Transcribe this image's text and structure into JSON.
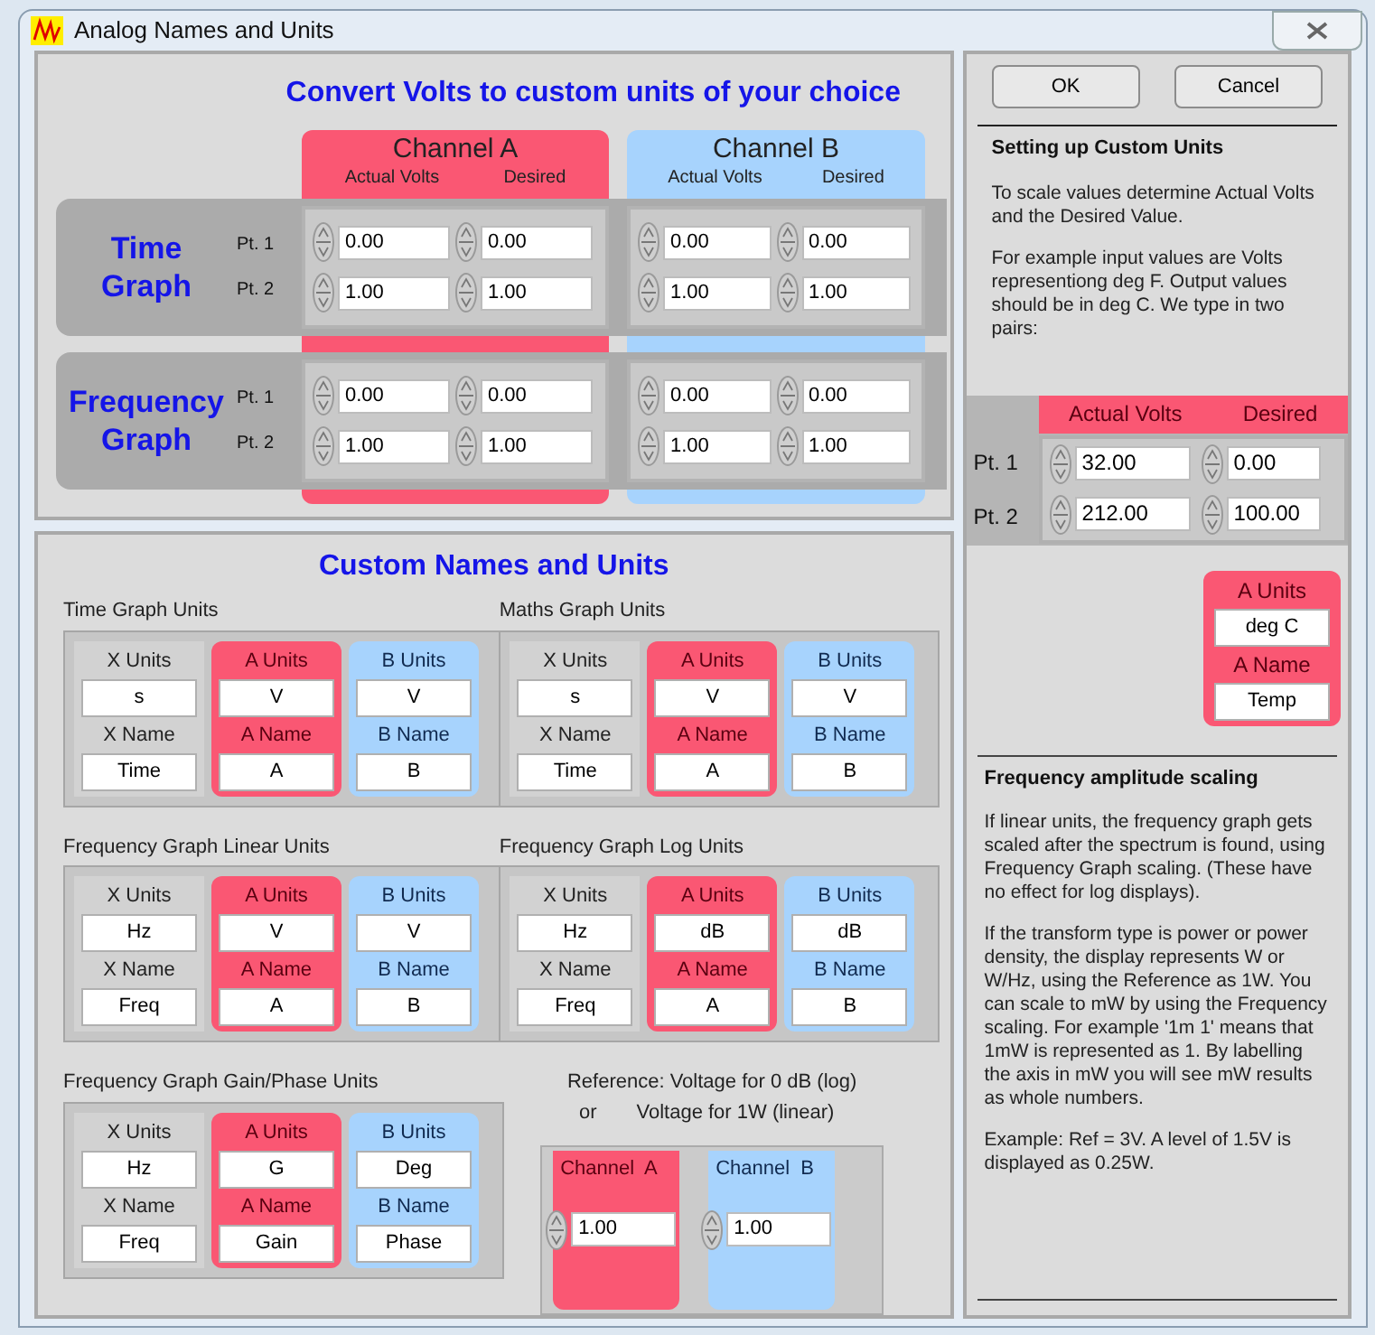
{
  "window": {
    "title": "Analog Names and Units"
  },
  "convert": {
    "title": "Convert Volts to custom units of your choice",
    "channels": [
      {
        "kind": "a",
        "name": "Channel A",
        "columns": [
          "Actual Volts",
          "Desired"
        ]
      },
      {
        "kind": "b",
        "name": "Channel B",
        "columns": [
          "Actual Volts",
          "Desired"
        ]
      }
    ],
    "graphs": [
      {
        "label_lines": [
          "Time",
          "Graph"
        ],
        "points": [
          "Pt. 1",
          "Pt. 2"
        ],
        "values": [
          [
            [
              "0.00",
              "0.00"
            ],
            [
              "1.00",
              "1.00"
            ]
          ],
          [
            [
              "0.00",
              "0.00"
            ],
            [
              "1.00",
              "1.00"
            ]
          ]
        ]
      },
      {
        "label_lines": [
          "Frequency",
          "Graph"
        ],
        "points": [
          "Pt. 1",
          "Pt. 2"
        ],
        "values": [
          [
            [
              "0.00",
              "0.00"
            ],
            [
              "1.00",
              "1.00"
            ]
          ],
          [
            [
              "0.00",
              "0.00"
            ],
            [
              "1.00",
              "1.00"
            ]
          ]
        ]
      }
    ]
  },
  "custom": {
    "title": "Custom Names and Units",
    "groups": [
      {
        "title": "Time Graph Units",
        "columns": [
          {
            "kind": "x",
            "units_label": "X Units",
            "units": "s",
            "name_label": "X Name",
            "name": "Time"
          },
          {
            "kind": "a",
            "units_label": "A Units",
            "units": "V",
            "name_label": "A Name",
            "name": "A"
          },
          {
            "kind": "b",
            "units_label": "B Units",
            "units": "V",
            "name_label": "B Name",
            "name": "B"
          }
        ]
      },
      {
        "title": "Maths Graph Units",
        "columns": [
          {
            "kind": "x",
            "units_label": "X Units",
            "units": "s",
            "name_label": "X Name",
            "name": "Time"
          },
          {
            "kind": "a",
            "units_label": "A Units",
            "units": "V",
            "name_label": "A Name",
            "name": "A"
          },
          {
            "kind": "b",
            "units_label": "B Units",
            "units": "V",
            "name_label": "B Name",
            "name": "B"
          }
        ]
      },
      {
        "title": "Frequency Graph Linear Units",
        "columns": [
          {
            "kind": "x",
            "units_label": "X Units",
            "units": "Hz",
            "name_label": "X Name",
            "name": "Freq"
          },
          {
            "kind": "a",
            "units_label": "A Units",
            "units": "V",
            "name_label": "A Name",
            "name": "A"
          },
          {
            "kind": "b",
            "units_label": "B Units",
            "units": "V",
            "name_label": "B Name",
            "name": "B"
          }
        ]
      },
      {
        "title": "Frequency Graph Log Units",
        "columns": [
          {
            "kind": "x",
            "units_label": "X Units",
            "units": "Hz",
            "name_label": "X Name",
            "name": "Freq"
          },
          {
            "kind": "a",
            "units_label": "A Units",
            "units": "dB",
            "name_label": "A Name",
            "name": "A"
          },
          {
            "kind": "b",
            "units_label": "B Units",
            "units": "dB",
            "name_label": "B Name",
            "name": "B"
          }
        ]
      },
      {
        "title": "Frequency Graph Gain/Phase Units",
        "columns": [
          {
            "kind": "x",
            "units_label": "X Units",
            "units": "Hz",
            "name_label": "X Name",
            "name": "Freq"
          },
          {
            "kind": "a",
            "units_label": "A Units",
            "units": "G",
            "name_label": "A Name",
            "name": "Gain"
          },
          {
            "kind": "b",
            "units_label": "B Units",
            "units": "Deg",
            "name_label": "B Name",
            "name": "Phase"
          }
        ]
      }
    ],
    "reference": {
      "caption": "Reference: Voltage for 0 dB (log)",
      "or": "or",
      "caption_2": "Voltage for 1W (linear)",
      "channels": [
        {
          "kind": "a",
          "label": "Channel  A",
          "value": "1.00"
        },
        {
          "kind": "b",
          "label": "Channel  B",
          "value": "1.00"
        }
      ]
    }
  },
  "buttons": [
    "OK",
    "Cancel"
  ],
  "help": {
    "heading": "Setting up Custom Units",
    "paragraphs": [
      "To scale values determine Actual Volts and the Desired Value.",
      "For example input values are Volts representiong deg F. Output values should be in deg C. We type in two pairs:"
    ]
  },
  "example": {
    "kind": "a",
    "columns": [
      "Actual Volts",
      "Desired"
    ],
    "rows": [
      {
        "label": "Pt. 1",
        "values": [
          "32.00",
          "0.00"
        ]
      },
      {
        "label": "Pt. 2",
        "values": [
          "212.00",
          "100.00"
        ]
      }
    ],
    "units_box": {
      "kind": "a",
      "units_label": "A Units",
      "units": "deg C",
      "name_label": "A Name",
      "name": "Temp"
    }
  },
  "help_2": {
    "heading": "Frequency amplitude scaling",
    "paragraphs": [
      "If linear units, the frequency graph gets scaled after the spectrum is found, using Frequency Graph scaling. (These have no effect for log displays).",
      "If the transform type is power or power density, the display represents W or W/Hz, using the Reference as 1W. You can scale to mW by using the Frequency scaling. For example '1m  1'  means that 1mW is represented as 1. By labelling the axis in mW you will see mW results as whole numbers.",
      "Example: Ref = 3V. A level of 1.5V is displayed as 0.25W."
    ]
  }
}
